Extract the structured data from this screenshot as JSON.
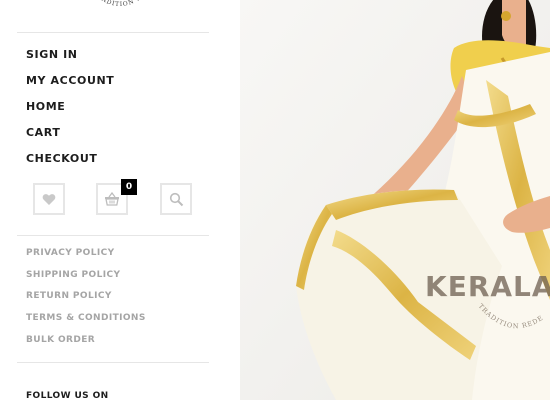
{
  "logo": {
    "arc_text": "TRADITION REDEFINED"
  },
  "nav": {
    "items": [
      {
        "label": "SIGN IN"
      },
      {
        "label": "MY ACCOUNT"
      },
      {
        "label": "HOME"
      },
      {
        "label": "CART"
      },
      {
        "label": "CHECKOUT"
      }
    ]
  },
  "icons": {
    "wishlist": "heart-icon",
    "cart": "basket-icon",
    "search": "search-icon",
    "cart_count": "0"
  },
  "policies": {
    "items": [
      {
        "label": "PRIVACY POLICY"
      },
      {
        "label": "SHIPPING POLICY"
      },
      {
        "label": "RETURN POLICY"
      },
      {
        "label": "TERMS & CONDITIONS"
      },
      {
        "label": "BULK ORDER"
      }
    ]
  },
  "follow": {
    "label": "FOLLOW US ON"
  },
  "hero": {
    "brand_text": "KERALA S",
    "brand_arc": "TRADITION REDE",
    "colors": {
      "saree": "#fbf8ef",
      "gold": "#e2bd4e",
      "skin": "#e9b08d",
      "hair": "#1a1410"
    }
  }
}
